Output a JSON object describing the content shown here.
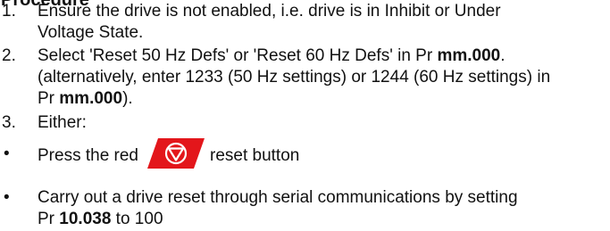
{
  "heading": "Procedure",
  "steps": [
    {
      "number": "1.",
      "line1": "Ensure the drive is not enabled, i.e. drive is in Inhibit or Under",
      "line2": "Voltage State."
    },
    {
      "number": "2.",
      "line1_text": "Select 'Reset 50 Hz Defs' or 'Reset 60 Hz Defs' in Pr ",
      "line1_bold": "mm.000",
      "line1_end": ".",
      "line2": "(alternatively, enter 1233 (50 Hz settings) or 1244 (60 Hz settings) in",
      "line3_text": "Pr ",
      "line3_bold": "mm.000",
      "line3_end": ")."
    },
    {
      "number": "3.",
      "line1": "Either:"
    }
  ],
  "bullets": [
    {
      "marker": "•",
      "text_before": "Press the red",
      "text_after": "reset button"
    },
    {
      "marker": "•",
      "line1": "Carry out a drive reset through serial communications by setting",
      "line2_text": "Pr ",
      "line2_bold": "10.038",
      "line2_end": " to 100"
    }
  ],
  "icons": {
    "reset_button": "stop-reset-icon",
    "reset_button_color": "#e3161b"
  }
}
